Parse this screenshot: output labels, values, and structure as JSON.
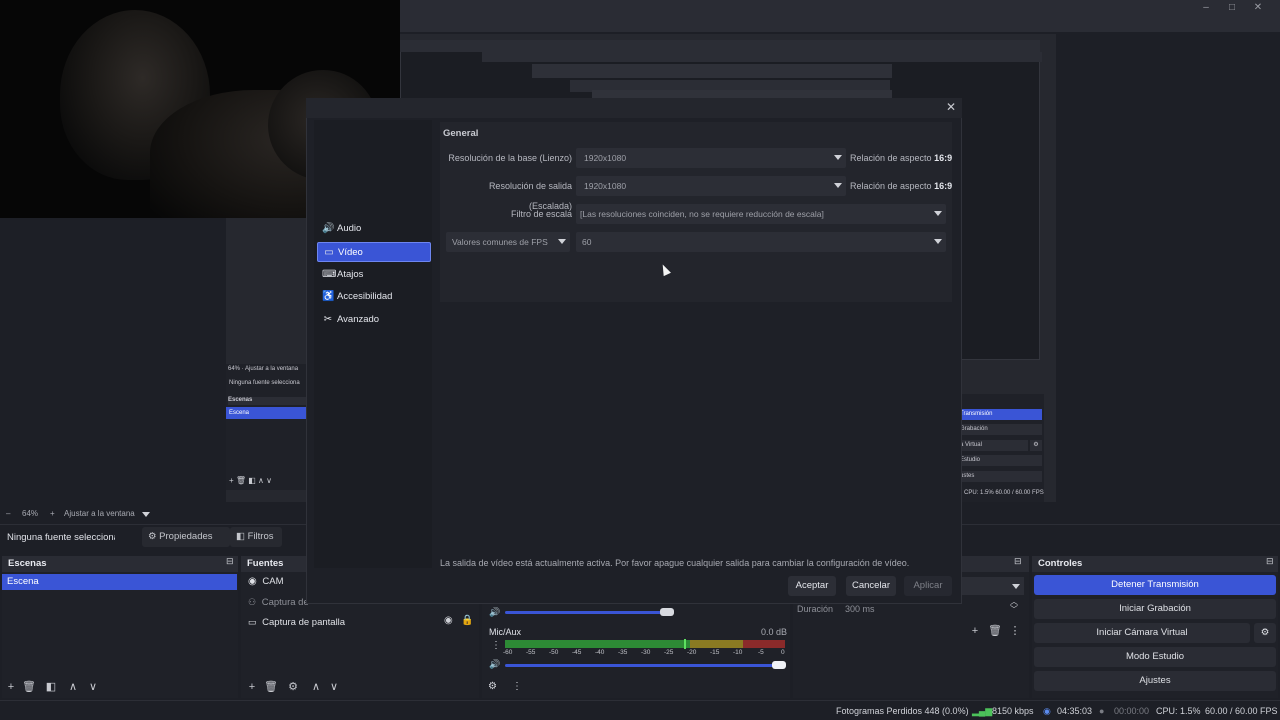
{
  "window": {
    "controls": {
      "minimize": "–",
      "maximize": "□",
      "close": "✕"
    }
  },
  "preview": {
    "zoom": "64%",
    "fit_label": "Ajustar a la ventana",
    "mini": {
      "zoom": "64%",
      "fit_label": "Ajustar a la ventana",
      "no_source": "Ninguna fuente selecciona",
      "scenes_header": "Escenas",
      "scene": "Escena",
      "controls": [
        "Transmisión",
        "Grabación",
        "a Virtual",
        "Estudio",
        "ustes"
      ],
      "status": "CPU: 1.5%   60.00 / 60.00 FPS"
    }
  },
  "toolbar": {
    "no_source": "Ninguna fuente seleccionac",
    "properties": "Propiedades",
    "filters": "Filtros"
  },
  "scenes": {
    "header": "Escenas",
    "items": [
      "Escena"
    ]
  },
  "sources": {
    "header": "Fuentes",
    "items": [
      {
        "name": "CAM",
        "icon": "camera-icon"
      },
      {
        "name": "Captura de juego",
        "icon": "gamepad-icon"
      },
      {
        "name": "Captura de pantalla",
        "icon": "monitor-icon"
      }
    ]
  },
  "mixer": {
    "channel": "Mic/Aux",
    "level": "0.0 dB",
    "ticks": [
      "-60",
      "-55",
      "-50",
      "-45",
      "-40",
      "-35",
      "-30",
      "-25",
      "-20",
      "-15",
      "-10",
      "-5",
      "0"
    ]
  },
  "transitions": {
    "duration_label": "Duración",
    "duration_value": "300 ms"
  },
  "controls": {
    "header": "Controles",
    "stop_stream": "Detener Transmisión",
    "start_recording": "Iniciar Grabación",
    "start_virtualcam": "Iniciar Cámara Virtual",
    "studio_mode": "Modo Estudio",
    "settings": "Ajustes"
  },
  "statusbar": {
    "dropped": "Fotogramas Perdidos 448 (0.0%)",
    "bitrate": "8150 kbps",
    "stream_time": "04:35:03",
    "rec_time": "00:00:00",
    "cpu": "CPU: 1.5%",
    "fps": "60.00 / 60.00 FPS"
  },
  "settings_dialog": {
    "nav": [
      {
        "label": "Audio",
        "icon": "speaker-icon",
        "active": false
      },
      {
        "label": "Vídeo",
        "icon": "monitor-icon",
        "active": true
      },
      {
        "label": "Atajos",
        "icon": "keyboard-icon",
        "active": false
      },
      {
        "label": "Accesibilidad",
        "icon": "accessibility-icon",
        "active": false
      },
      {
        "label": "Avanzado",
        "icon": "tools-icon",
        "active": false
      }
    ],
    "section": "General",
    "base_res_label": "Resolución de la base (Lienzo)",
    "base_res_value": "1920x1080",
    "base_ratio_label": "Relación de aspecto",
    "base_ratio_value": "16:9",
    "out_res_label": "Resolución de salida (Escalada)",
    "out_res_value": "1920x1080",
    "out_ratio_label": "Relación de aspecto",
    "out_ratio_value": "16:9",
    "filter_label": "Filtro de escala",
    "filter_value": "[Las resoluciones coinciden, no se requiere reducción de escala]",
    "fps_type": "Valores comunes de FPS",
    "fps_value": "60",
    "notice": "La salida de vídeo está actualmente activa. Por favor apague cualquier salida para cambiar la configuración de vídeo.",
    "accept": "Aceptar",
    "cancel": "Cancelar",
    "apply": "Aplicar"
  }
}
